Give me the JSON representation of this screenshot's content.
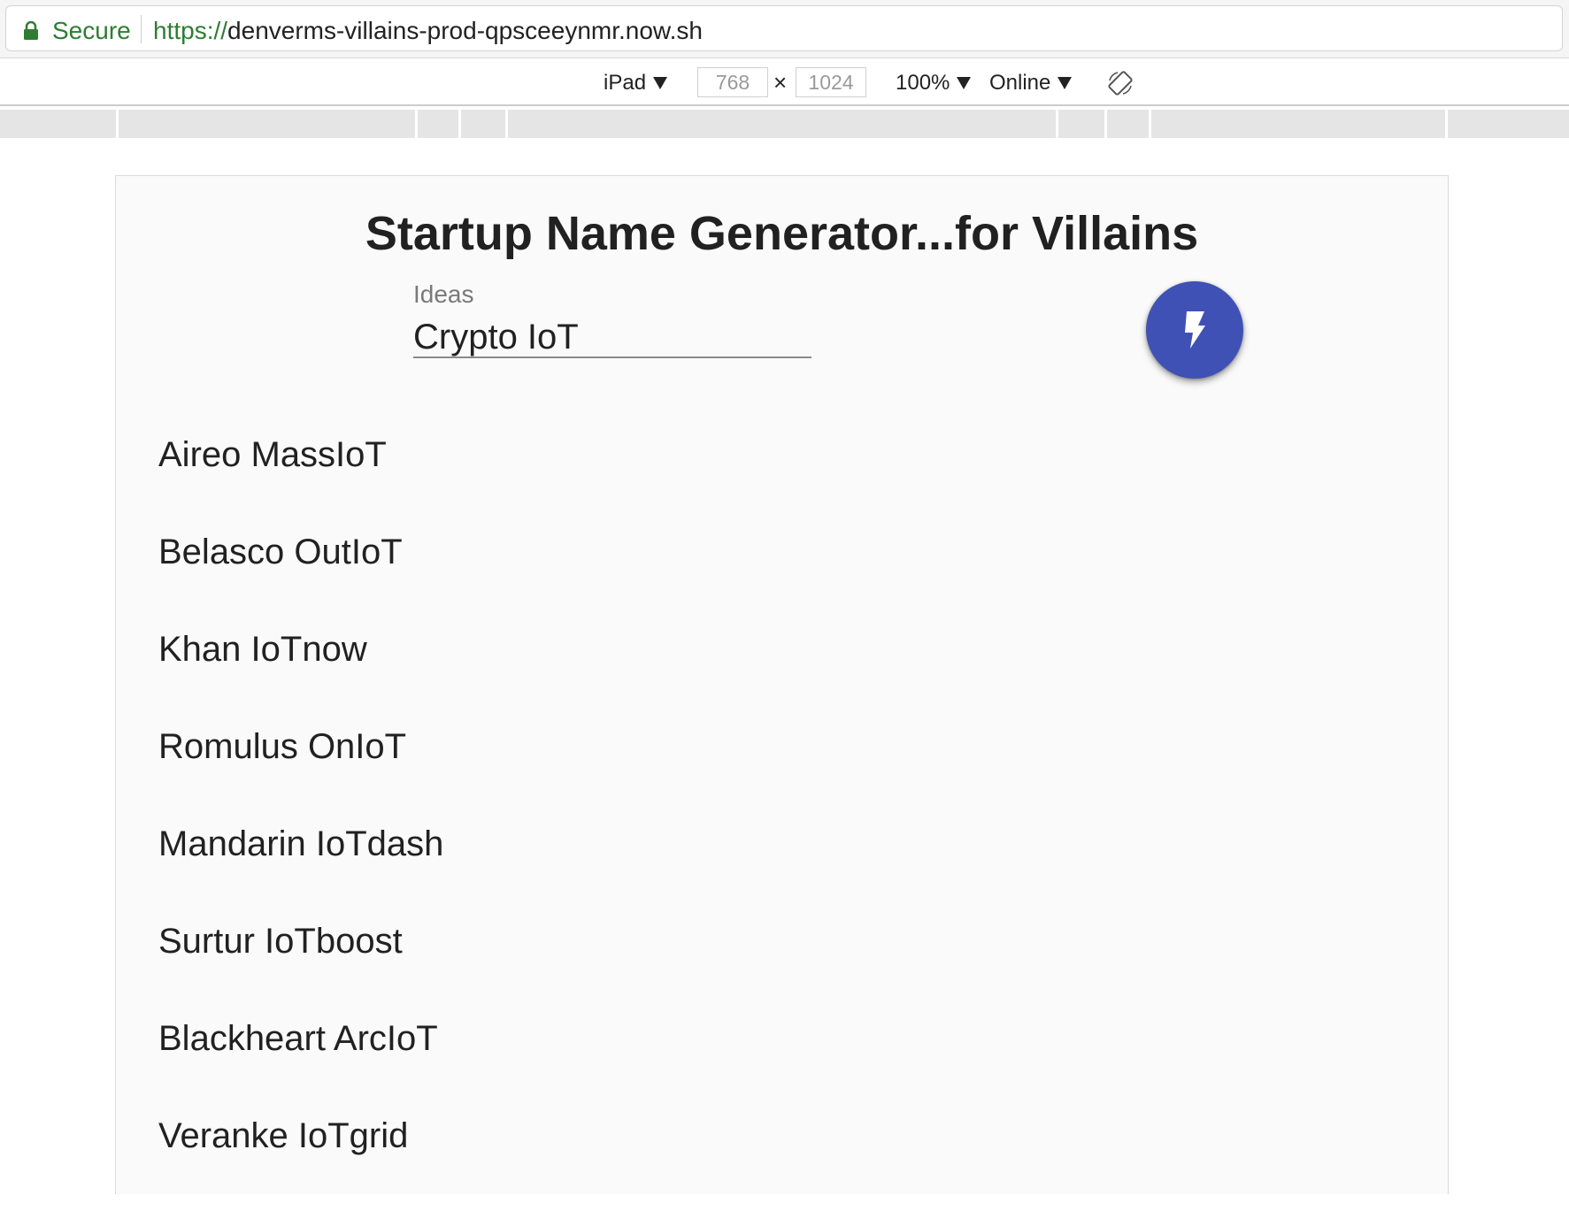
{
  "browser": {
    "secure_label": "Secure",
    "url_scheme": "https://",
    "url_host": "denverms-villains-prod-qpsceeynmr.now.sh"
  },
  "device_toolbar": {
    "device": "iPad",
    "width": "768",
    "height": "1024",
    "zoom": "100%",
    "network": "Online"
  },
  "page": {
    "title": "Startup Name Generator...for Villains",
    "ideas_label": "Ideas",
    "ideas_value": "Crypto IoT",
    "accent_color": "#3f51b5",
    "results": [
      "Aireo MassIoT",
      "Belasco OutIoT",
      "Khan IoTnow",
      "Romulus OnIoT",
      "Mandarin IoTdash",
      "Surtur IoTboost",
      "Blackheart ArcIoT",
      "Veranke IoTgrid"
    ]
  }
}
